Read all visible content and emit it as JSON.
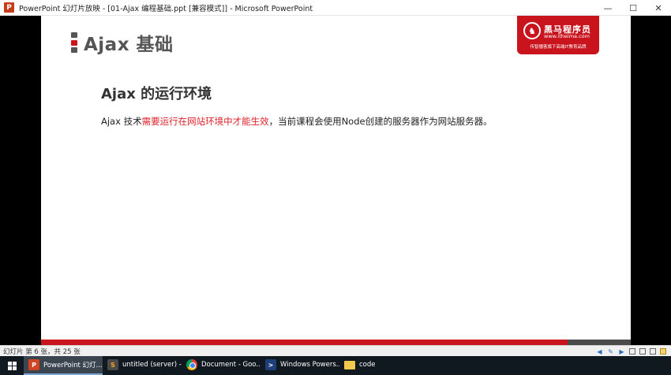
{
  "window": {
    "app_icon": "P",
    "title": "PowerPoint 幻灯片放映 - [01-Ajax 编程基础.ppt [兼容模式]] - Microsoft PowerPoint",
    "controls": [
      "—",
      "☐",
      "✕"
    ]
  },
  "slide": {
    "heading": "Ajax 基础",
    "marker_colors": [
      "#555555",
      "#c9141e",
      "#555555"
    ],
    "logo": {
      "name": "黑马程序员",
      "url": "www.itheima.com",
      "slogan": "传智播客旗下高端IT教育品牌"
    },
    "sub_heading": "Ajax 的运行环境",
    "body": {
      "prefix": "Ajax 技术",
      "highlight": "需要运行在网站环境中才能生效",
      "suffix": "，当前课程会使用Node创建的服务器作为网站服务器。"
    },
    "colors": {
      "accent": "#c9141e",
      "highlight": "#e0232a"
    }
  },
  "statusbar": {
    "text": "幻灯片 第 6 张，共 25 张"
  },
  "taskbar": {
    "items": [
      {
        "label": "PowerPoint 幻灯...",
        "icon": "powerpoint-icon",
        "glyph": "P"
      },
      {
        "label": "untitled (server) -...",
        "icon": "sublime-text-icon",
        "glyph": "S"
      },
      {
        "label": "Document - Goo...",
        "icon": "chrome-icon",
        "glyph": ""
      },
      {
        "label": "Windows Powers...",
        "icon": "powershell-icon",
        "glyph": ">"
      },
      {
        "label": "code",
        "icon": "folder-icon",
        "glyph": ""
      }
    ]
  }
}
